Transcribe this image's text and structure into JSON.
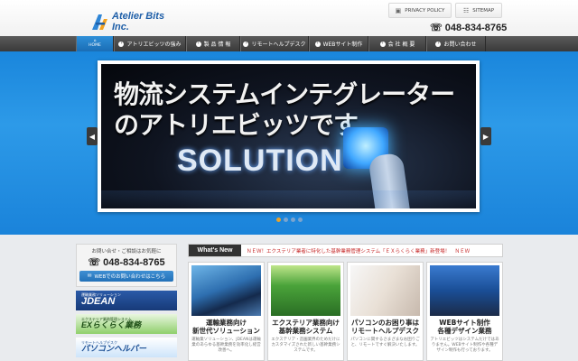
{
  "header": {
    "logo_text": "Atelier Bits Inc.",
    "privacy_label": "PRIVACY POLICY",
    "sitemap_label": "SITEMAP",
    "phone": "048-834-8765"
  },
  "nav": {
    "items": [
      {
        "label": "HOME",
        "icon": "home-icon"
      },
      {
        "label": "アトリエビッツの強み"
      },
      {
        "label": "製 品 情 報"
      },
      {
        "label": "リモートヘルプデスク"
      },
      {
        "label": "WEBサイト制作"
      },
      {
        "label": "会 社 概 要"
      },
      {
        "label": "お問い合わせ"
      }
    ]
  },
  "hero": {
    "line1": "物流システムインテグレーター",
    "line2": "のアトリエビッツです。",
    "line3": "SOLUTION",
    "slide_count": 4,
    "active_slide": 1
  },
  "sidebar": {
    "contact_heading": "お問い合せ・ご相談はお気軽に",
    "phone": "048-834-8765",
    "contact_button": "WEBでのお問い合わせはこちら",
    "banners": [
      {
        "sub": "運輸業務ソリューション",
        "main": "JDEAN"
      },
      {
        "sub": "エクステリア業務管理システム",
        "main": "EXらくらく業務"
      },
      {
        "sub": "リモートヘルプデスク",
        "main": "パソコンヘルパー"
      }
    ]
  },
  "news": {
    "label": "What's New",
    "ticker": "ＮＥＷ！エクステリア業者に特化した基幹業務管理システム「ＥＸらくらく業務」新登場！　ＮＥＷ"
  },
  "cards": [
    {
      "title": "運輸業務向け\n新世代ソリューション",
      "desc": "運輸業ソリューション、JDEANは運輸業のあらゆる基幹業務を効率化し経営改善へ。"
    },
    {
      "title": "エクステリア業務向け\n基幹業務システム",
      "desc": "エクステリア・造園業界のためだけにカスタマイズされた新しい基幹業務システムです。"
    },
    {
      "title": "パソコンのお困り事は\nリモートヘルプデスク",
      "desc": "パソコンに関するさまざまなお困りごと、リモートですぐ解決いたします。"
    },
    {
      "title": "WEBサイト制作\n各種デザイン業務",
      "desc": "アトリエビッツはシステムだけではありません。WEBサイト制作や各種デザイン制作も行っております。"
    }
  ],
  "colors": {
    "accent_blue": "#1a86dc",
    "nav_dark": "#3a3a3a",
    "ticker_red": "#c62828"
  }
}
